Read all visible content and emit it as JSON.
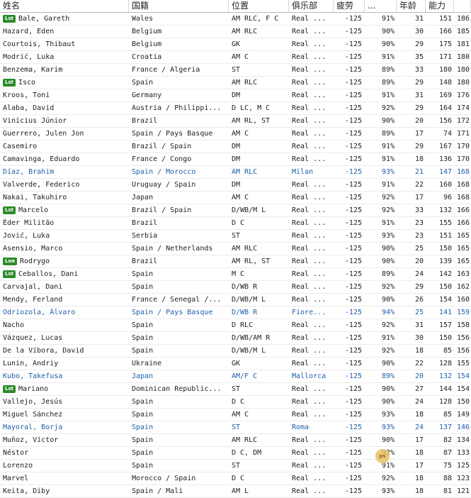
{
  "columns": {
    "name": "姓名",
    "nationality": "国籍",
    "position": "位置",
    "club": "俱乐部",
    "fatigue": "疲劳",
    "pct": "...",
    "age": "年龄",
    "ability": "能力",
    "potential": ""
  },
  "badge_colors": {
    "Lst": "#2c8a2c",
    "Loa": "#2c8a2c"
  },
  "highlight_color": "#1f5fa8",
  "watermark_label": "ps",
  "rows": [
    {
      "badge": "Lst",
      "name": "Bale, Gareth",
      "nat": "Wales",
      "pos": "AM RLC, F C",
      "club": "Real ...",
      "fat": "-125",
      "pct": "91%",
      "age": "31",
      "ab": "151",
      "pa": "186",
      "hl": false
    },
    {
      "badge": "",
      "name": "Hazard, Eden",
      "nat": "Belgium",
      "pos": "AM RLC",
      "club": "Real ...",
      "fat": "-125",
      "pct": "90%",
      "age": "30",
      "ab": "166",
      "pa": "185",
      "hl": false
    },
    {
      "badge": "",
      "name": "Courtois, Thibaut",
      "nat": "Belgium",
      "pos": "GK",
      "club": "Real ...",
      "fat": "-125",
      "pct": "90%",
      "age": "29",
      "ab": "175",
      "pa": "181",
      "hl": false
    },
    {
      "badge": "",
      "name": "Modrić, Luka",
      "nat": "Croatia",
      "pos": "AM C",
      "club": "Real ...",
      "fat": "-125",
      "pct": "91%",
      "age": "35",
      "ab": "171",
      "pa": "180",
      "hl": false
    },
    {
      "badge": "",
      "name": "Benzema, Karim",
      "nat": "France / Algeria",
      "pos": "ST",
      "club": "Real ...",
      "fat": "-125",
      "pct": "89%",
      "age": "33",
      "ab": "180",
      "pa": "180",
      "hl": false
    },
    {
      "badge": "Lst",
      "name": "Isco",
      "nat": "Spain",
      "pos": "AM RLC",
      "club": "Real ...",
      "fat": "-125",
      "pct": "89%",
      "age": "29",
      "ab": "148",
      "pa": "180",
      "hl": false
    },
    {
      "badge": "",
      "name": "Kroos, Toni",
      "nat": "Germany",
      "pos": "DM",
      "club": "Real ...",
      "fat": "-125",
      "pct": "91%",
      "age": "31",
      "ab": "169",
      "pa": "176",
      "hl": false
    },
    {
      "badge": "",
      "name": "Alaba, David",
      "nat": "Austria / Philippi...",
      "pos": "D LC, M C",
      "club": "Real ...",
      "fat": "-125",
      "pct": "92%",
      "age": "29",
      "ab": "164",
      "pa": "174",
      "hl": false
    },
    {
      "badge": "",
      "name": "Vinícius Júnior",
      "nat": "Brazil",
      "pos": "AM RL, ST",
      "club": "Real ...",
      "fat": "-125",
      "pct": "90%",
      "age": "20",
      "ab": "156",
      "pa": "172",
      "hl": false
    },
    {
      "badge": "",
      "name": "Guerrero, Julen Jon",
      "nat": "Spain / Pays Basque",
      "pos": "AM C",
      "club": "Real ...",
      "fat": "-125",
      "pct": "89%",
      "age": "17",
      "ab": "74",
      "pa": "171",
      "hl": false
    },
    {
      "badge": "",
      "name": "Casemiro",
      "nat": "Brazil / Spain",
      "pos": "DM",
      "club": "Real ...",
      "fat": "-125",
      "pct": "91%",
      "age": "29",
      "ab": "167",
      "pa": "170",
      "hl": false
    },
    {
      "badge": "",
      "name": "Camavinga, Eduardo",
      "nat": "France / Congo",
      "pos": "DM",
      "club": "Real ...",
      "fat": "-125",
      "pct": "91%",
      "age": "18",
      "ab": "136",
      "pa": "170",
      "hl": false
    },
    {
      "badge": "",
      "name": "Díaz, Brahim",
      "nat": "Spain / Morocco",
      "pos": "AM RLC",
      "club": "Milan",
      "fat": "-125",
      "pct": "93%",
      "age": "21",
      "ab": "147",
      "pa": "168",
      "hl": true
    },
    {
      "badge": "",
      "name": "Valverde, Federico",
      "nat": "Uruguay / Spain",
      "pos": "DM",
      "club": "Real ...",
      "fat": "-125",
      "pct": "91%",
      "age": "22",
      "ab": "160",
      "pa": "168",
      "hl": false
    },
    {
      "badge": "",
      "name": "Nakai, Takuhiro",
      "nat": "Japan",
      "pos": "AM C",
      "club": "Real ...",
      "fat": "-125",
      "pct": "92%",
      "age": "17",
      "ab": "96",
      "pa": "168",
      "hl": false
    },
    {
      "badge": "Lst",
      "name": "Marcelo",
      "nat": "Brazil / Spain",
      "pos": "D/WB/M L",
      "club": "Real ...",
      "fat": "-125",
      "pct": "92%",
      "age": "33",
      "ab": "132",
      "pa": "166",
      "hl": false
    },
    {
      "badge": "",
      "name": "Éder Militão",
      "nat": "Brazil",
      "pos": "D C",
      "club": "Real ...",
      "fat": "-125",
      "pct": "91%",
      "age": "23",
      "ab": "155",
      "pa": "166",
      "hl": false
    },
    {
      "badge": "",
      "name": "Jović, Luka",
      "nat": "Serbia",
      "pos": "ST",
      "club": "Real ...",
      "fat": "-125",
      "pct": "93%",
      "age": "23",
      "ab": "151",
      "pa": "165",
      "hl": false
    },
    {
      "badge": "",
      "name": "Asensio, Marco",
      "nat": "Spain / Netherlands",
      "pos": "AM RLC",
      "club": "Real ...",
      "fat": "-125",
      "pct": "90%",
      "age": "25",
      "ab": "150",
      "pa": "165",
      "hl": false
    },
    {
      "badge": "Loa",
      "name": "Rodrygo",
      "nat": "Brazil",
      "pos": "AM RL, ST",
      "club": "Real ...",
      "fat": "-125",
      "pct": "90%",
      "age": "20",
      "ab": "139",
      "pa": "165",
      "hl": false
    },
    {
      "badge": "Lst",
      "name": "Ceballos, Dani",
      "nat": "Spain",
      "pos": "M C",
      "club": "Real ...",
      "fat": "-125",
      "pct": "89%",
      "age": "24",
      "ab": "142",
      "pa": "163",
      "hl": false
    },
    {
      "badge": "",
      "name": "Carvajal, Dani",
      "nat": "Spain",
      "pos": "D/WB R",
      "club": "Real ...",
      "fat": "-125",
      "pct": "92%",
      "age": "29",
      "ab": "150",
      "pa": "162",
      "hl": false
    },
    {
      "badge": "",
      "name": "Mendy, Ferland",
      "nat": "France / Senegal /...",
      "pos": "D/WB/M L",
      "club": "Real ...",
      "fat": "-125",
      "pct": "90%",
      "age": "26",
      "ab": "154",
      "pa": "160",
      "hl": false
    },
    {
      "badge": "",
      "name": "Odriozola, Álvaro",
      "nat": "Spain / Pays Basque",
      "pos": "D/WB R",
      "club": "Fiore...",
      "fat": "-125",
      "pct": "94%",
      "age": "25",
      "ab": "141",
      "pa": "159",
      "hl": true
    },
    {
      "badge": "",
      "name": "Nacho",
      "nat": "Spain",
      "pos": "D RLC",
      "club": "Real ...",
      "fat": "-125",
      "pct": "92%",
      "age": "31",
      "ab": "157",
      "pa": "158",
      "hl": false
    },
    {
      "badge": "",
      "name": "Vázquez, Lucas",
      "nat": "Spain",
      "pos": "D/WB/AM R",
      "club": "Real ...",
      "fat": "-125",
      "pct": "91%",
      "age": "30",
      "ab": "150",
      "pa": "156",
      "hl": false
    },
    {
      "badge": "",
      "name": "De la Víbora, David",
      "nat": "Spain",
      "pos": "D/WB/M L",
      "club": "Real ...",
      "fat": "-125",
      "pct": "92%",
      "age": "18",
      "ab": "85",
      "pa": "156",
      "hl": false
    },
    {
      "badge": "",
      "name": "Lunin, Andriy",
      "nat": "Ukraine",
      "pos": "GK",
      "club": "Real ...",
      "fat": "-125",
      "pct": "90%",
      "age": "22",
      "ab": "128",
      "pa": "155",
      "hl": false
    },
    {
      "badge": "",
      "name": "Kubo, Takefusa",
      "nat": "Japan",
      "pos": "AM/F C",
      "club": "Mallorca",
      "fat": "-125",
      "pct": "89%",
      "age": "20",
      "ab": "132",
      "pa": "154",
      "hl": true
    },
    {
      "badge": "Lst",
      "name": "Mariano",
      "nat": "Dominican Republic...",
      "pos": "ST",
      "club": "Real ...",
      "fat": "-125",
      "pct": "90%",
      "age": "27",
      "ab": "144",
      "pa": "154",
      "hl": false
    },
    {
      "badge": "",
      "name": "Vallejo, Jesús",
      "nat": "Spain",
      "pos": "D C",
      "club": "Real ...",
      "fat": "-125",
      "pct": "90%",
      "age": "24",
      "ab": "128",
      "pa": "150",
      "hl": false
    },
    {
      "badge": "",
      "name": "Miguel Sánchez",
      "nat": "Spain",
      "pos": "AM C",
      "club": "Real ...",
      "fat": "-125",
      "pct": "93%",
      "age": "18",
      "ab": "85",
      "pa": "149",
      "hl": false
    },
    {
      "badge": "",
      "name": "Mayoral, Borja",
      "nat": "Spain",
      "pos": "ST",
      "club": "Roma",
      "fat": "-125",
      "pct": "93%",
      "age": "24",
      "ab": "137",
      "pa": "146",
      "hl": true
    },
    {
      "badge": "",
      "name": "Muñoz, Víctor",
      "nat": "Spain",
      "pos": "AM RLC",
      "club": "Real ...",
      "fat": "-125",
      "pct": "90%",
      "age": "17",
      "ab": "82",
      "pa": "134",
      "hl": false
    },
    {
      "badge": "",
      "name": "Néstor",
      "nat": "Spain",
      "pos": "D C, DM",
      "club": "Real ...",
      "fat": "-125",
      "pct": "92%",
      "age": "18",
      "ab": "87",
      "pa": "133",
      "hl": false
    },
    {
      "badge": "",
      "name": "Lorenzo",
      "nat": "Spain",
      "pos": "ST",
      "club": "Real ...",
      "fat": "-125",
      "pct": "91%",
      "age": "17",
      "ab": "75",
      "pa": "125",
      "hl": false
    },
    {
      "badge": "",
      "name": "Marvel",
      "nat": "Morocco / Spain",
      "pos": "D C",
      "club": "Real ...",
      "fat": "-125",
      "pct": "92%",
      "age": "18",
      "ab": "88",
      "pa": "123",
      "hl": false
    },
    {
      "badge": "",
      "name": "Keita, Diby",
      "nat": "Spain / Mali",
      "pos": "AM L",
      "club": "Real ...",
      "fat": "-125",
      "pct": "93%",
      "age": "18",
      "ab": "81",
      "pa": "121",
      "hl": false
    }
  ]
}
